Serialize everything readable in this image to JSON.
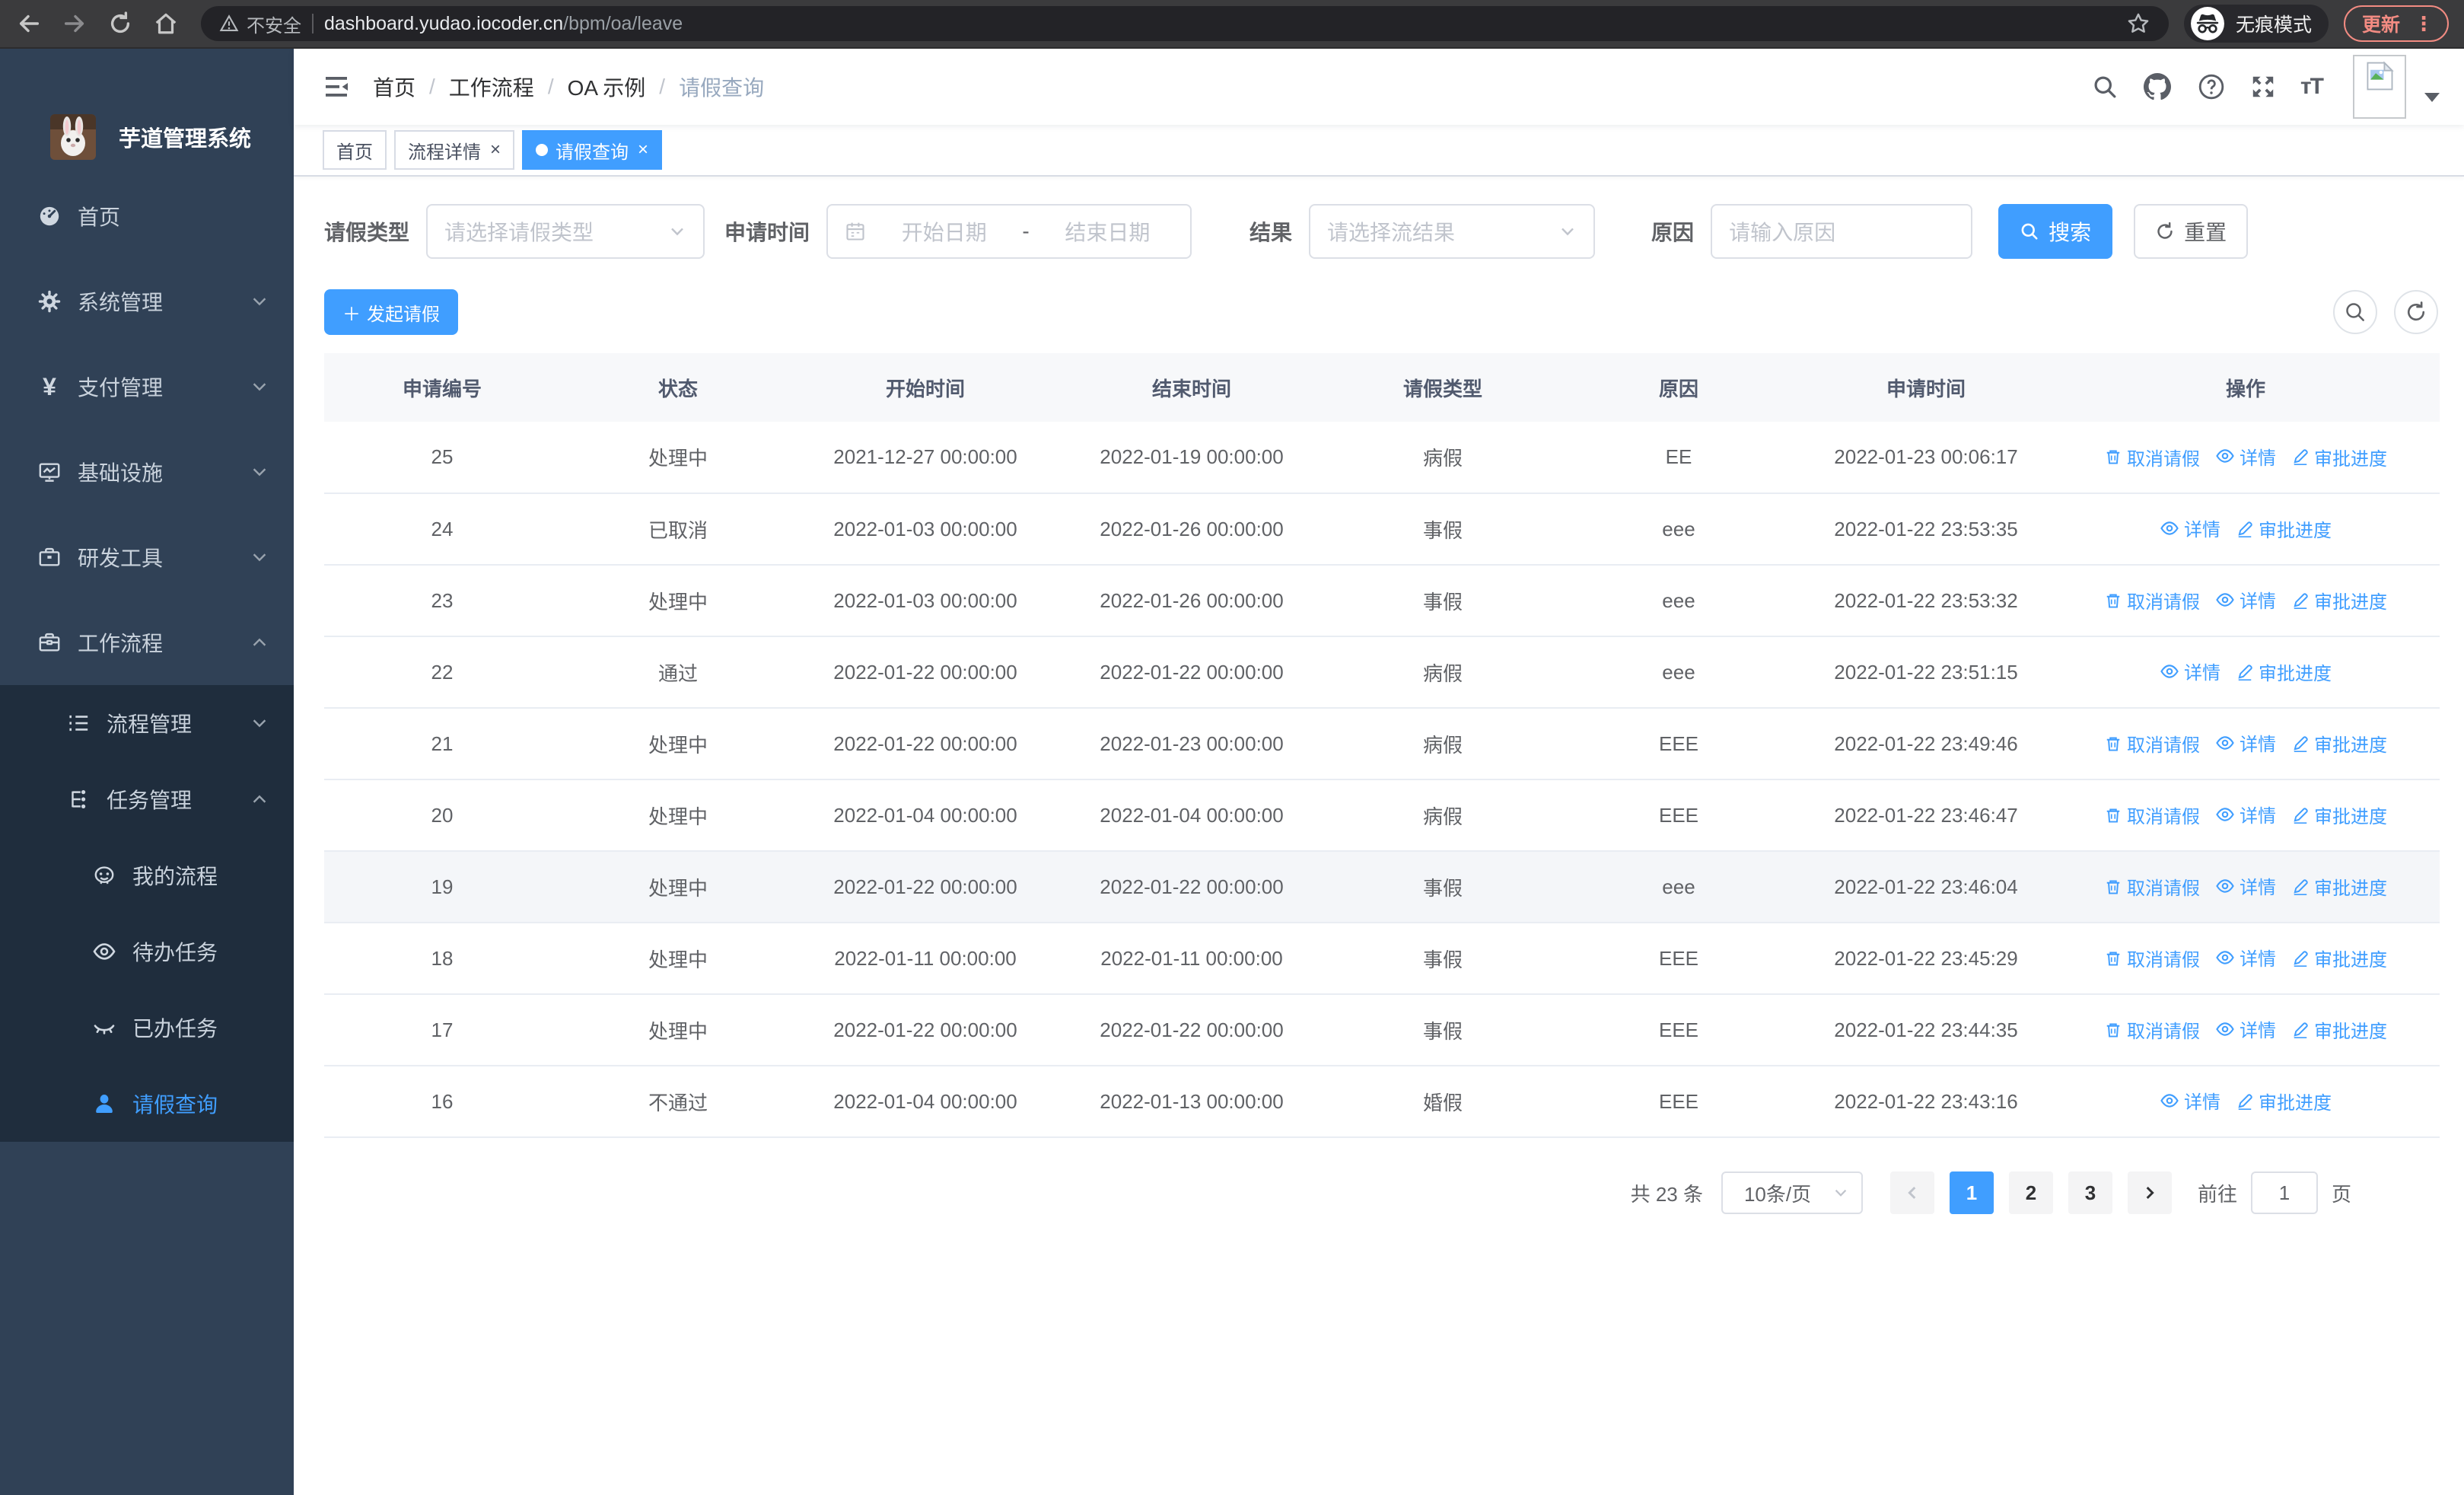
{
  "browser": {
    "security_warning": "不安全",
    "url_host": "dashboard.yudao.iocoder.cn",
    "url_path": "/bpm/oa/leave",
    "incognito_label": "无痕模式",
    "update_label": "更新"
  },
  "sidebar": {
    "title": "芋道管理系统",
    "items": [
      {
        "key": "home",
        "label": "首页",
        "icon": "dashboard-icon",
        "level": 1
      },
      {
        "key": "system",
        "label": "系统管理",
        "icon": "gear-icon",
        "level": 1,
        "chevron": "down"
      },
      {
        "key": "payment",
        "label": "支付管理",
        "icon": "yen-icon",
        "level": 1,
        "chevron": "down"
      },
      {
        "key": "infra",
        "label": "基础设施",
        "icon": "monitor-icon",
        "level": 1,
        "chevron": "down"
      },
      {
        "key": "devtools",
        "label": "研发工具",
        "icon": "toolbox-icon",
        "level": 1,
        "chevron": "down"
      },
      {
        "key": "workflow",
        "label": "工作流程",
        "icon": "briefcase-icon",
        "level": 1,
        "chevron": "up"
      },
      {
        "key": "process-mgmt",
        "label": "流程管理",
        "icon": "list-icon",
        "level": 2,
        "chevron": "down"
      },
      {
        "key": "task-mgmt",
        "label": "任务管理",
        "icon": "flow-icon",
        "level": 2,
        "chevron": "up"
      },
      {
        "key": "my-process",
        "label": "我的流程",
        "icon": "face-icon",
        "level": 3
      },
      {
        "key": "todo-tasks",
        "label": "待办任务",
        "icon": "eye-open-icon",
        "level": 3
      },
      {
        "key": "done-tasks",
        "label": "已办任务",
        "icon": "eye-closed-icon",
        "level": 3
      },
      {
        "key": "leave-query",
        "label": "请假查询",
        "icon": "user-icon",
        "level": 3,
        "active": true
      }
    ]
  },
  "header": {
    "breadcrumbs": [
      "首页",
      "工作流程",
      "OA 示例",
      "请假查询"
    ]
  },
  "tabs": [
    {
      "label": "首页",
      "closable": false,
      "active": false
    },
    {
      "label": "流程详情",
      "closable": true,
      "active": false
    },
    {
      "label": "请假查询",
      "closable": true,
      "active": true
    }
  ],
  "filters": {
    "leave_type_label": "请假类型",
    "leave_type_placeholder": "请选择请假类型",
    "apply_time_label": "申请时间",
    "date_start_placeholder": "开始日期",
    "date_separator": "-",
    "date_end_placeholder": "结束日期",
    "result_label": "结果",
    "result_placeholder": "请选择流结果",
    "reason_label": "原因",
    "reason_placeholder": "请输入原因",
    "search_label": "搜索",
    "reset_label": "重置"
  },
  "toolbar": {
    "create_label": "发起请假"
  },
  "table": {
    "columns": [
      "申请编号",
      "状态",
      "开始时间",
      "结束时间",
      "请假类型",
      "原因",
      "申请时间",
      "操作"
    ],
    "action_labels": {
      "cancel": "取消请假",
      "detail": "详情",
      "progress": "审批进度"
    },
    "rows": [
      {
        "id": "25",
        "status": "处理中",
        "start": "2021-12-27 00:00:00",
        "end": "2022-01-19 00:00:00",
        "type": "病假",
        "reason": "EE",
        "applied": "2022-01-23 00:06:17",
        "actions": [
          "cancel",
          "detail",
          "progress"
        ],
        "highlight": false
      },
      {
        "id": "24",
        "status": "已取消",
        "start": "2022-01-03 00:00:00",
        "end": "2022-01-26 00:00:00",
        "type": "事假",
        "reason": "eee",
        "applied": "2022-01-22 23:53:35",
        "actions": [
          "detail",
          "progress"
        ],
        "highlight": false
      },
      {
        "id": "23",
        "status": "处理中",
        "start": "2022-01-03 00:00:00",
        "end": "2022-01-26 00:00:00",
        "type": "事假",
        "reason": "eee",
        "applied": "2022-01-22 23:53:32",
        "actions": [
          "cancel",
          "detail",
          "progress"
        ],
        "highlight": false
      },
      {
        "id": "22",
        "status": "通过",
        "start": "2022-01-22 00:00:00",
        "end": "2022-01-22 00:00:00",
        "type": "病假",
        "reason": "eee",
        "applied": "2022-01-22 23:51:15",
        "actions": [
          "detail",
          "progress"
        ],
        "highlight": false
      },
      {
        "id": "21",
        "status": "处理中",
        "start": "2022-01-22 00:00:00",
        "end": "2022-01-23 00:00:00",
        "type": "病假",
        "reason": "EEE",
        "applied": "2022-01-22 23:49:46",
        "actions": [
          "cancel",
          "detail",
          "progress"
        ],
        "highlight": false
      },
      {
        "id": "20",
        "status": "处理中",
        "start": "2022-01-04 00:00:00",
        "end": "2022-01-04 00:00:00",
        "type": "病假",
        "reason": "EEE",
        "applied": "2022-01-22 23:46:47",
        "actions": [
          "cancel",
          "detail",
          "progress"
        ],
        "highlight": false
      },
      {
        "id": "19",
        "status": "处理中",
        "start": "2022-01-22 00:00:00",
        "end": "2022-01-22 00:00:00",
        "type": "事假",
        "reason": "eee",
        "applied": "2022-01-22 23:46:04",
        "actions": [
          "cancel",
          "detail",
          "progress"
        ],
        "highlight": true
      },
      {
        "id": "18",
        "status": "处理中",
        "start": "2022-01-11 00:00:00",
        "end": "2022-01-11 00:00:00",
        "type": "事假",
        "reason": "EEE",
        "applied": "2022-01-22 23:45:29",
        "actions": [
          "cancel",
          "detail",
          "progress"
        ],
        "highlight": false
      },
      {
        "id": "17",
        "status": "处理中",
        "start": "2022-01-22 00:00:00",
        "end": "2022-01-22 00:00:00",
        "type": "事假",
        "reason": "EEE",
        "applied": "2022-01-22 23:44:35",
        "actions": [
          "cancel",
          "detail",
          "progress"
        ],
        "highlight": false
      },
      {
        "id": "16",
        "status": "不通过",
        "start": "2022-01-04 00:00:00",
        "end": "2022-01-13 00:00:00",
        "type": "婚假",
        "reason": "EEE",
        "applied": "2022-01-22 23:43:16",
        "actions": [
          "detail",
          "progress"
        ],
        "highlight": false
      }
    ]
  },
  "pagination": {
    "total_text": "共 23 条",
    "page_size_text": "10条/页",
    "pages": [
      "1",
      "2",
      "3"
    ],
    "active_page": "1",
    "goto_label": "前往",
    "goto_value": "1",
    "goto_suffix": "页"
  },
  "colors": {
    "primary": "#409eff",
    "sidebar_bg": "#304156",
    "submenu_bg": "#1f2d3d"
  }
}
